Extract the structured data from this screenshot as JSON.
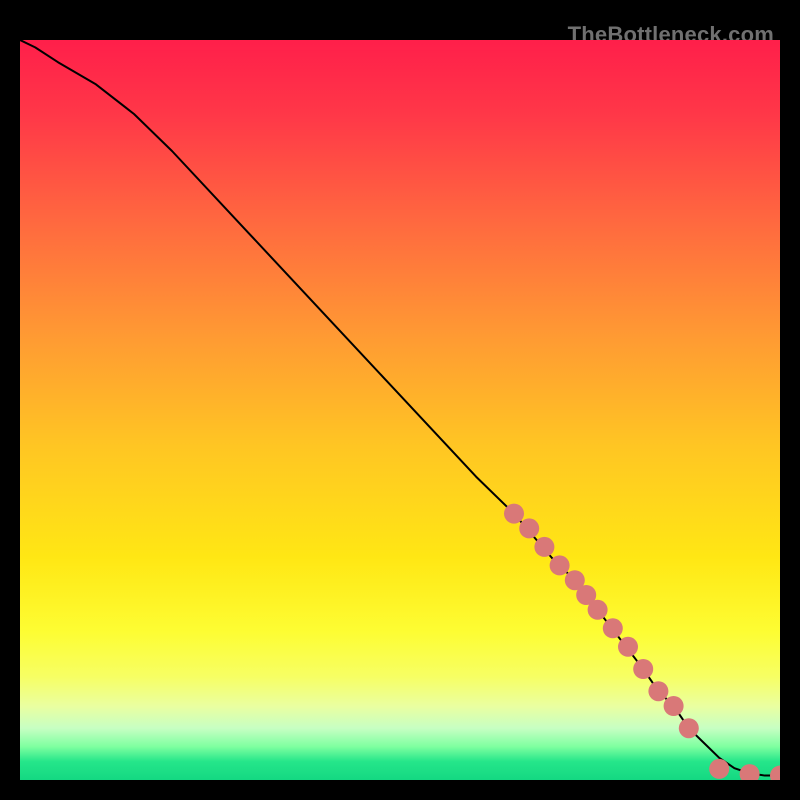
{
  "watermark": "TheBottleneck.com",
  "gradient": {
    "stops": [
      {
        "offset": 0.0,
        "color": "#ff1f4a"
      },
      {
        "offset": 0.1,
        "color": "#ff3748"
      },
      {
        "offset": 0.25,
        "color": "#ff6a3f"
      },
      {
        "offset": 0.4,
        "color": "#ff9a33"
      },
      {
        "offset": 0.55,
        "color": "#ffc623"
      },
      {
        "offset": 0.7,
        "color": "#ffe714"
      },
      {
        "offset": 0.8,
        "color": "#fdfd33"
      },
      {
        "offset": 0.86,
        "color": "#f7ff63"
      },
      {
        "offset": 0.9,
        "color": "#eaffa0"
      },
      {
        "offset": 0.93,
        "color": "#c7ffc3"
      },
      {
        "offset": 0.955,
        "color": "#7effa0"
      },
      {
        "offset": 0.975,
        "color": "#25e68a"
      },
      {
        "offset": 1.0,
        "color": "#14d882"
      }
    ]
  },
  "chart_data": {
    "type": "line",
    "title": "",
    "xlabel": "",
    "ylabel": "",
    "xlim": [
      0,
      100
    ],
    "ylim": [
      0,
      100
    ],
    "grid": false,
    "legend": false,
    "series": [
      {
        "name": "curve",
        "style": "line",
        "color": "#000000",
        "width": 2,
        "x": [
          0,
          2,
          5,
          10,
          15,
          20,
          30,
          40,
          50,
          60,
          65,
          70,
          73,
          76,
          79,
          82,
          84,
          86,
          88,
          90,
          92,
          94,
          96,
          98,
          100
        ],
        "y": [
          100,
          99,
          97,
          94,
          90,
          85,
          74,
          63,
          52,
          41,
          36,
          30,
          27,
          23,
          19,
          15,
          12,
          10,
          7,
          5,
          3,
          1.6,
          0.9,
          0.6,
          0.6
        ]
      },
      {
        "name": "points",
        "style": "marker",
        "color": "#d97878",
        "radius": 10,
        "x": [
          65,
          67,
          69,
          71,
          73,
          74.5,
          76,
          78,
          80,
          82,
          84,
          86,
          88,
          92,
          96,
          100
        ],
        "y": [
          36,
          34,
          31.5,
          29,
          27,
          25,
          23,
          20.5,
          18,
          15,
          12,
          10,
          7,
          1.5,
          0.8,
          0.6
        ]
      }
    ]
  }
}
